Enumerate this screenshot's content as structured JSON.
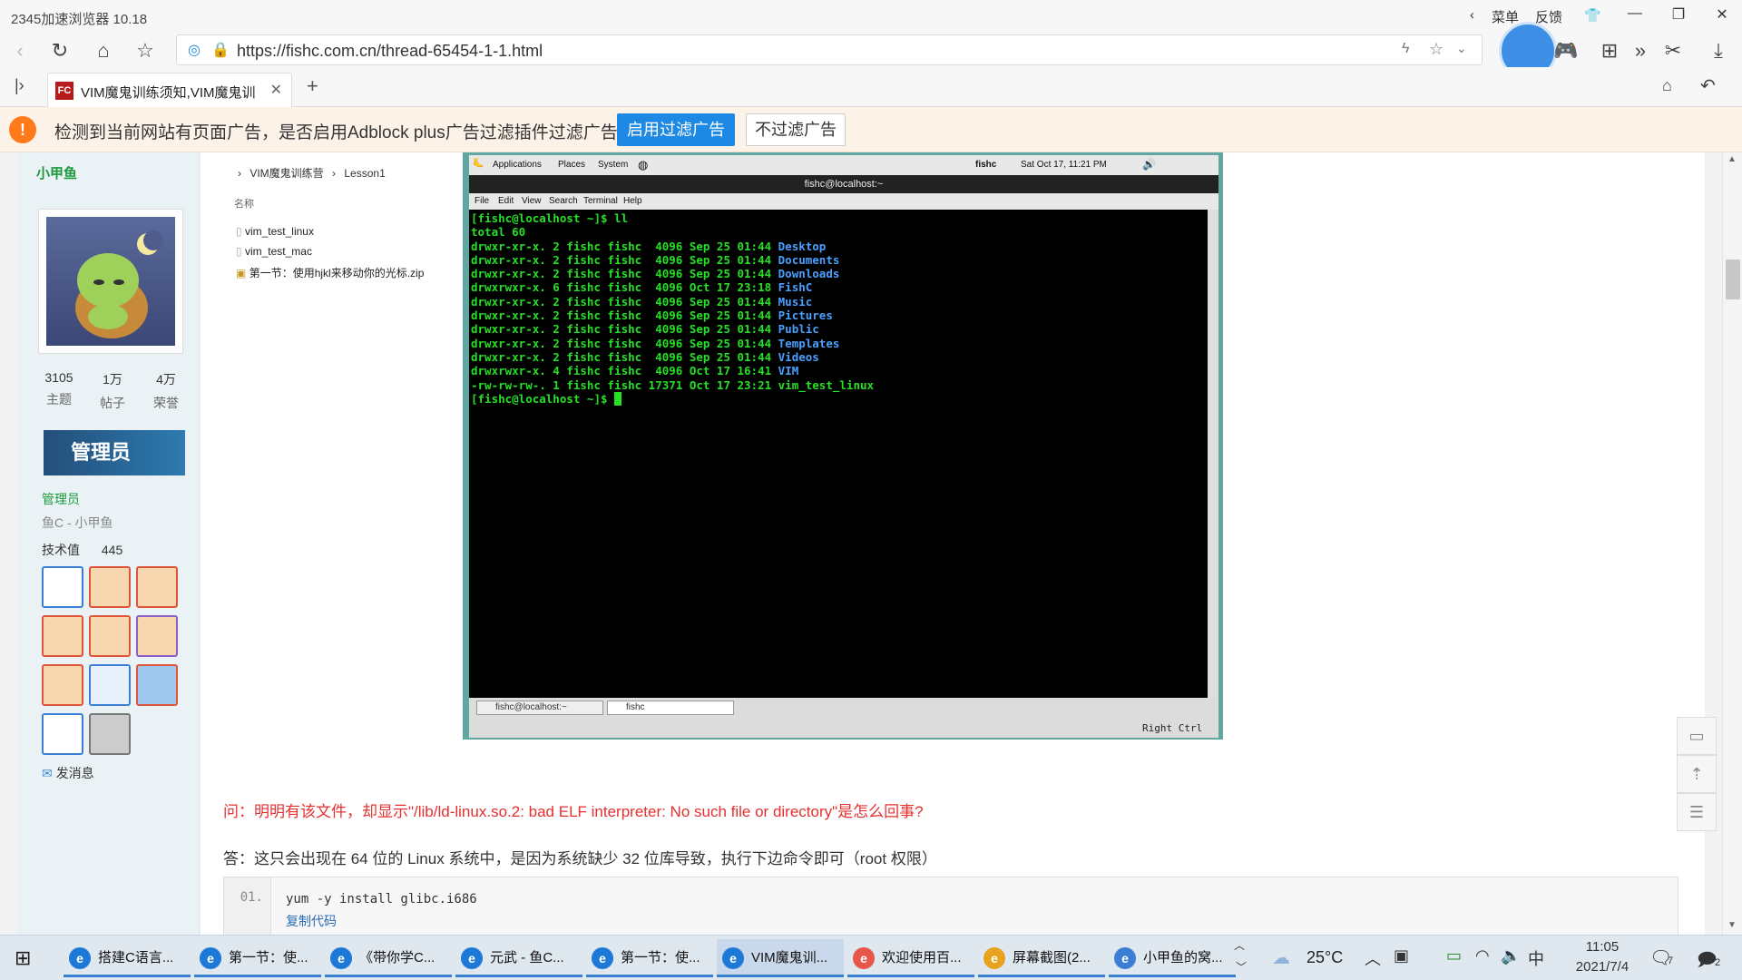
{
  "browser": {
    "title": "2345加速浏览器 10.18",
    "menu_label": "菜单",
    "feedback_label": "反馈",
    "url": "https://fishc.com.cn/thread-65454-1-1.html",
    "tab_title": "VIM魔鬼训练须知,VIM魔鬼训",
    "tab_favicon": "FC"
  },
  "adblock": {
    "message": "检测到当前网站有页面广告，是否启用Adblock plus广告过滤插件过滤广告?",
    "enable_label": "启用过滤广告",
    "skip_label": "不过滤广告"
  },
  "sidebar": {
    "username": "小甲鱼",
    "stats": [
      {
        "value": "3105",
        "label": "主题"
      },
      {
        "value": "1万",
        "label": "帖子"
      },
      {
        "value": "4万",
        "label": "荣誉"
      }
    ],
    "banner_text": "管理员",
    "role": "管理员",
    "group": "鱼C - 小甲鱼",
    "tech_label": "技术值",
    "tech_value": "445",
    "send_message": "发消息"
  },
  "explorer": {
    "breadcrumb_1": "VIM魔鬼训练营",
    "breadcrumb_2": "Lesson1",
    "column_name": "名称",
    "files": [
      "vim_test_linux",
      "vim_test_mac",
      "第一节：使用hjkl来移动你的光标.zip"
    ]
  },
  "vm": {
    "panel_items": [
      "Applications",
      "Places",
      "System"
    ],
    "panel_user": "fishc",
    "panel_time": "Sat Oct 17, 11:21 PM",
    "term_title": "fishc@localhost:~",
    "term_menu": [
      "File",
      "Edit",
      "View",
      "Search",
      "Terminal",
      "Help"
    ],
    "terminal_lines": [
      {
        "t": "[fishc@localhost ~]$ ll",
        "c": "#26e026"
      },
      {
        "t": "total 60",
        "c": "#26e026"
      },
      {
        "p": "drwxr-xr-x. 2 fishc fishc  4096 Sep 25 01:44 ",
        "n": "Desktop"
      },
      {
        "p": "drwxr-xr-x. 2 fishc fishc  4096 Sep 25 01:44 ",
        "n": "Documents"
      },
      {
        "p": "drwxr-xr-x. 2 fishc fishc  4096 Sep 25 01:44 ",
        "n": "Downloads"
      },
      {
        "p": "drwxrwxr-x. 6 fishc fishc  4096 Oct 17 23:18 ",
        "n": "FishC"
      },
      {
        "p": "drwxr-xr-x. 2 fishc fishc  4096 Sep 25 01:44 ",
        "n": "Music"
      },
      {
        "p": "drwxr-xr-x. 2 fishc fishc  4096 Sep 25 01:44 ",
        "n": "Pictures"
      },
      {
        "p": "drwxr-xr-x. 2 fishc fishc  4096 Sep 25 01:44 ",
        "n": "Public"
      },
      {
        "p": "drwxr-xr-x. 2 fishc fishc  4096 Sep 25 01:44 ",
        "n": "Templates"
      },
      {
        "p": "drwxr-xr-x. 2 fishc fishc  4096 Sep 25 01:44 ",
        "n": "Videos"
      },
      {
        "p": "drwxrwxr-x. 4 fishc fishc  4096 Oct 17 16:41 ",
        "n": "VIM"
      },
      {
        "p": "-rw-rw-rw-. 1 fishc fishc 17371 Oct 17 23:21 ",
        "n": "vim_test_linux",
        "nc": "#26e026"
      },
      {
        "t": "[fishc@localhost ~]$ ",
        "c": "#26e026",
        "cursor": true
      }
    ],
    "task_1": "fishc@localhost:~",
    "task_2": "fishc",
    "status_right": "Right Ctrl"
  },
  "content": {
    "question": "问：明明有该文件，却显示\"/lib/ld-linux.so.2: bad ELF interpreter: No such file or directory\"是怎么回事?",
    "answer": "答：这只会出现在 64 位的 Linux 系统中，是因为系统缺少 32 位库导致，执行下边命令即可（root 权限）",
    "code_line_no": "01.",
    "code": "yum -y install glibc.i686",
    "copy_label": "复制代码"
  },
  "taskbar": {
    "items": [
      {
        "label": "搭建C语言...",
        "active": false
      },
      {
        "label": "第一节：使...",
        "active": false
      },
      {
        "label": "《带你学C...",
        "active": false
      },
      {
        "label": "元武 - 鱼C...",
        "active": false
      },
      {
        "label": "第一节：使...",
        "active": false
      },
      {
        "label": "VIM魔鬼训...",
        "active": true
      },
      {
        "label": "欢迎使用百...",
        "active": false
      },
      {
        "label": "屏幕截图(2...",
        "active": false
      },
      {
        "label": "小甲鱼的窝...",
        "active": false
      }
    ],
    "weather": "25°C",
    "ime": "中",
    "time": "11:05",
    "date": "2021/7/4",
    "notif_count": "2",
    "badge_7": "7"
  },
  "colors": {
    "accent": "#1e88e5",
    "term_green": "#26e026",
    "term_blue": "#4aa0ff",
    "question_red": "#e53030"
  }
}
